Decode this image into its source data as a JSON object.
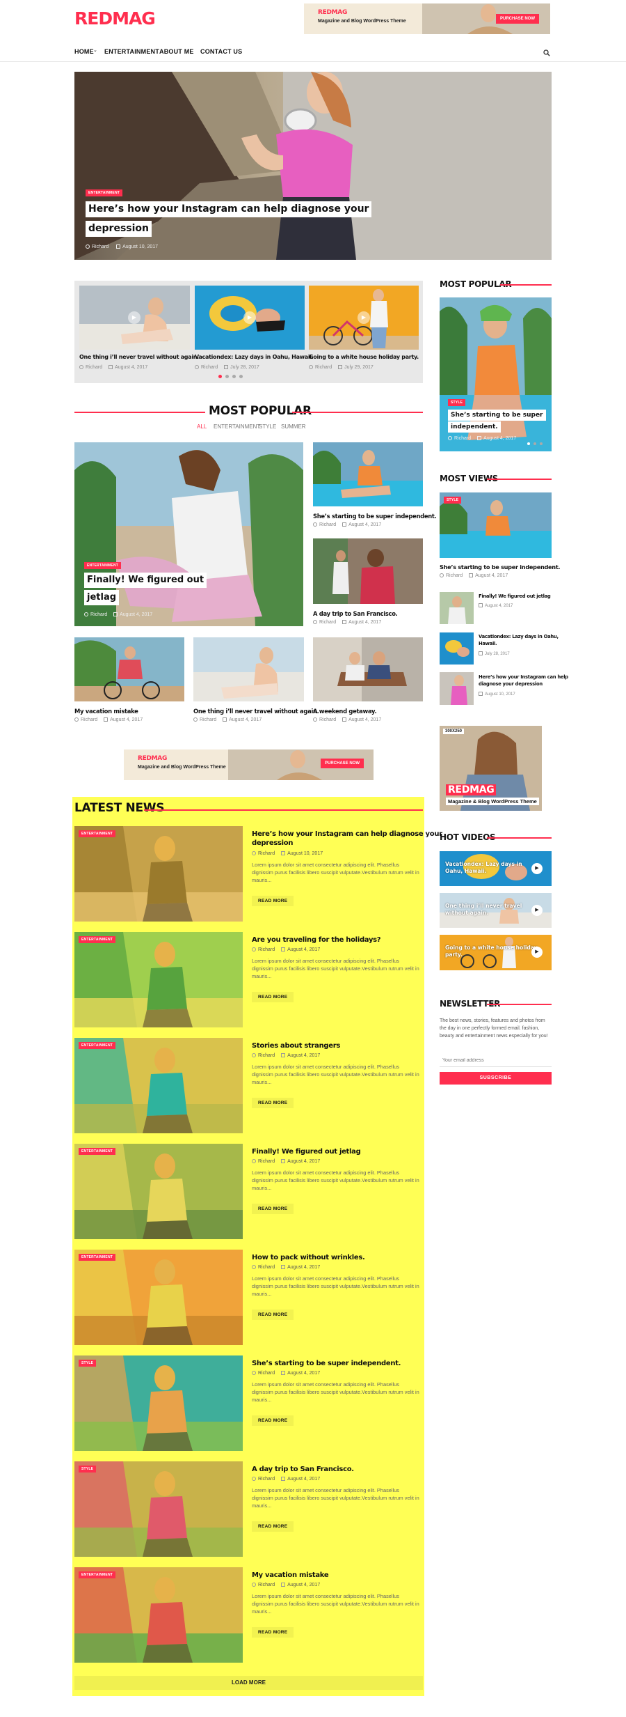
{
  "header": {
    "logo": "REDMAG",
    "ad_title": "REDMAG",
    "ad_sub": "Magazine and Blog WordPress Theme",
    "ad_button": "PURCHASE NOW"
  },
  "nav": {
    "items": [
      "HOME",
      "ENTERTAINMENT",
      "ABOUT ME",
      "CONTACT US"
    ],
    "search_icon": "search-icon"
  },
  "hero": {
    "badge": "ENTERTAINMENT",
    "title_line1": "Here’s how your Instagram can help diagnose your",
    "title_line2": "depression",
    "author": "Richard",
    "date": "August 10, 2017"
  },
  "slider": {
    "items": [
      {
        "title": "One thing i’ll never travel without again.",
        "author": "Richard",
        "date": "August 4, 2017"
      },
      {
        "title": "Vacationdex: Lazy days in Oahu, Hawaii.",
        "author": "Richard",
        "date": "July 28, 2017"
      },
      {
        "title": "Going to a white house holiday party.",
        "author": "Richard",
        "date": "July 29, 2017"
      }
    ]
  },
  "most_popular_main": {
    "heading": "MOST POPULAR",
    "tabs": [
      "ALL",
      "ENTERTAINMENT",
      "STYLE",
      "SUMMER"
    ],
    "big": {
      "badge": "ENTERTAINMENT",
      "title_line1": "Finally! We figured out",
      "title_line2": "jetlag",
      "author": "Richard",
      "date": "August 4, 2017"
    },
    "small": [
      {
        "title": "She’s starting to be super independent.",
        "author": "Richard",
        "date": "August 4, 2017"
      },
      {
        "title": "A day trip to San Francisco.",
        "author": "Richard",
        "date": "August 4, 2017"
      },
      {
        "title": "My vacation mistake",
        "author": "Richard",
        "date": "August 4, 2017"
      },
      {
        "title": "One thing i’ll never travel without again.",
        "author": "Richard",
        "date": "August 4, 2017"
      },
      {
        "title": "A weekend getaway.",
        "author": "Richard",
        "date": "August 4, 2017"
      }
    ]
  },
  "mid_ad": {
    "title": "REDMAG",
    "sub": "Magazine and Blog WordPress Theme",
    "button": "PURCHASE NOW"
  },
  "latest_news": {
    "heading": "LATEST NEWS",
    "excerpt": "Lorem ipsum dolor sit amet consectetur adipiscing elit. Phasellus dignissim purus facilisis libero suscipit vulputate.Vestibulum rutrum velit in mauris...",
    "read_more": "READ MORE",
    "load_more": "LOAD MORE",
    "items": [
      {
        "badge": "ENTERTAINMENT",
        "title_line1": "Here’s how your Instagram can help diagnose your",
        "title_line2": "depression",
        "author": "Richard",
        "date": "August 10, 2017"
      },
      {
        "badge": "ENTERTAINMENT",
        "title_line1": "Are you traveling for the holidays?",
        "title_line2": "",
        "author": "Richard",
        "date": "August 4, 2017"
      },
      {
        "badge": "ENTERTAINMENT",
        "title_line1": "Stories about strangers",
        "title_line2": "",
        "author": "Richard",
        "date": "August 4, 2017"
      },
      {
        "badge": "ENTERTAINMENT",
        "title_line1": "Finally! We figured out jetlag",
        "title_line2": "",
        "author": "Richard",
        "date": "August 4, 2017"
      },
      {
        "badge": "ENTERTAINMENT",
        "title_line1": "How to pack without wrinkles.",
        "title_line2": "",
        "author": "Richard",
        "date": "August 4, 2017"
      },
      {
        "badge": "STYLE",
        "title_line1": "She’s starting to be super independent.",
        "title_line2": "",
        "author": "Richard",
        "date": "August 4, 2017"
      },
      {
        "badge": "STYLE",
        "title_line1": "A day trip to San Francisco.",
        "title_line2": "",
        "author": "Richard",
        "date": "August 4, 2017"
      },
      {
        "badge": "ENTERTAINMENT",
        "title_line1": "My vacation mistake",
        "title_line2": "",
        "author": "Richard",
        "date": "August 4, 2017"
      }
    ]
  },
  "sidebar": {
    "popular": {
      "heading": "MOST POPULAR",
      "badge": "STYLE",
      "title_line1": "She’s starting to be super",
      "title_line2": "independent.",
      "author": "Richard",
      "date": "August 4, 2017"
    },
    "views": {
      "heading": "MOST VIEWS",
      "big": {
        "badge": "STYLE",
        "title": "She’s starting to be super independent.",
        "author": "Richard",
        "date": "August 4, 2017"
      },
      "items": [
        {
          "title_line1": "Finally! We figured out jetlag",
          "title_line2": "",
          "date": "August 4, 2017"
        },
        {
          "title_line1": "Vacationdex: Lazy days in Oahu,",
          "title_line2": "Hawaii.",
          "date": "July 28, 2017"
        },
        {
          "title_line1": "Here’s how your Instagram can help",
          "title_line2": "diagnose your depression",
          "date": "August 10, 2017"
        }
      ]
    },
    "ad": {
      "size": "300X250",
      "title": "REDMAG",
      "sub": "Magazine & Blog WordPress Theme"
    },
    "videos": {
      "heading": "HOT VIDEOS",
      "items": [
        {
          "title_line1": "Vacationdex: Lazy days in",
          "title_line2": "Oahu, Hawaii."
        },
        {
          "title_line1": "One thing i’ll never travel",
          "title_line2": "without again."
        },
        {
          "title_line1": "Going to a white house holiday",
          "title_line2": "party."
        }
      ]
    },
    "newsletter": {
      "heading": "NEWSLETTER",
      "text": "The best news, stories, features and photos from the day in one perfectly formed email. fashion, beauty and entertainment news especially for you!",
      "placeholder": "Your email address",
      "button": "SUBSCRIBE"
    }
  },
  "colors": {
    "accent": "#ff2e4e",
    "highlight": "#ffff55"
  }
}
